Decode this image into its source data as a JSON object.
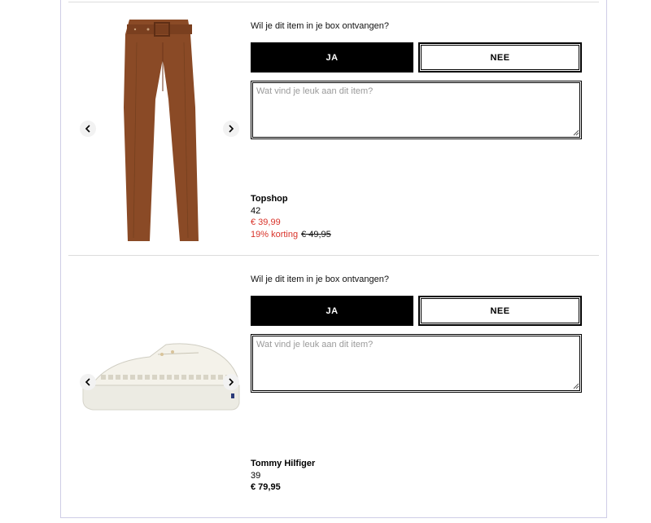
{
  "items": [
    {
      "question": "Wil je dit item in je box ontvangen?",
      "yes_label": "JA",
      "no_label": "NEE",
      "comment_placeholder": "Wat vind je leuk aan dit item?",
      "image_icon": "trousers-image",
      "brand": "Topshop",
      "size": "42",
      "price": "€ 39,99",
      "discount": "19% korting",
      "old_price": "€ 49,95",
      "colors": {
        "product": "#8a4a26",
        "sale": "#d9332a"
      }
    },
    {
      "question": "Wil je dit item in je box ontvangen?",
      "yes_label": "JA",
      "no_label": "NEE",
      "comment_placeholder": "Wat vind je leuk aan dit item?",
      "image_icon": "sneaker-image",
      "brand": "Tommy Hilfiger",
      "size": "39",
      "price": "€ 79,95",
      "colors": {
        "product": "#efece4"
      }
    }
  ],
  "nav": {
    "prev_icon": "chevron-left-icon",
    "next_icon": "chevron-right-icon"
  }
}
